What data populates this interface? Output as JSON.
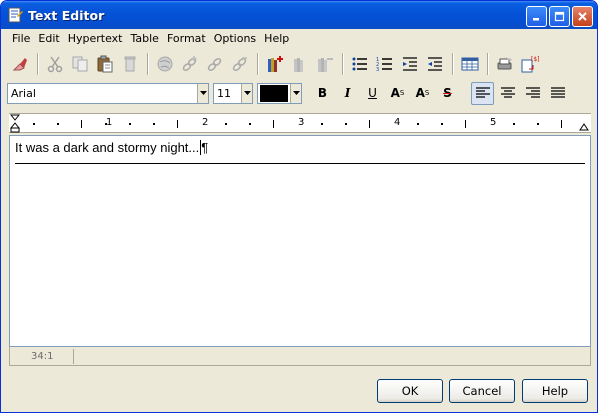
{
  "window": {
    "title": "Text Editor",
    "title_buttons": [
      "minimize-icon",
      "maximize-icon",
      "close-icon"
    ]
  },
  "menu": [
    "File",
    "Edit",
    "Hypertext",
    "Table",
    "Format",
    "Options",
    "Help"
  ],
  "toolbar": {
    "icons": [
      "eraser-icon",
      "cut-icon",
      "copy-icon",
      "paste-icon",
      "delete-icon",
      "globe-icon",
      "link-add-icon",
      "link-edit-icon",
      "link-remove-icon",
      "book-add-icon",
      "book-icon",
      "book-remove-icon",
      "bullet-list-icon",
      "numbered-list-icon",
      "indent-icon",
      "outdent-icon",
      "table-icon",
      "print-icon",
      "insert-field-icon"
    ]
  },
  "format": {
    "font": "Arial",
    "size": "11",
    "color": "#000000",
    "bold": "B",
    "italic": "I",
    "underline": "U",
    "superscript": "A",
    "superscript_mark": "S",
    "subscript": "A",
    "subscript_mark": "S",
    "strikethrough": "S",
    "alignment": "left"
  },
  "ruler": {
    "numbers": [
      "1",
      "2",
      "3",
      "4",
      "5"
    ]
  },
  "editor": {
    "text": "It was a dark and stormy night...",
    "pilcrow": "¶"
  },
  "status": {
    "position": "34:1"
  },
  "buttons": {
    "ok": "OK",
    "cancel": "Cancel",
    "help": "Help"
  },
  "colors": {
    "titlebar": "#0653d8",
    "background": "#ece9d8",
    "border": "#7f9db9"
  }
}
